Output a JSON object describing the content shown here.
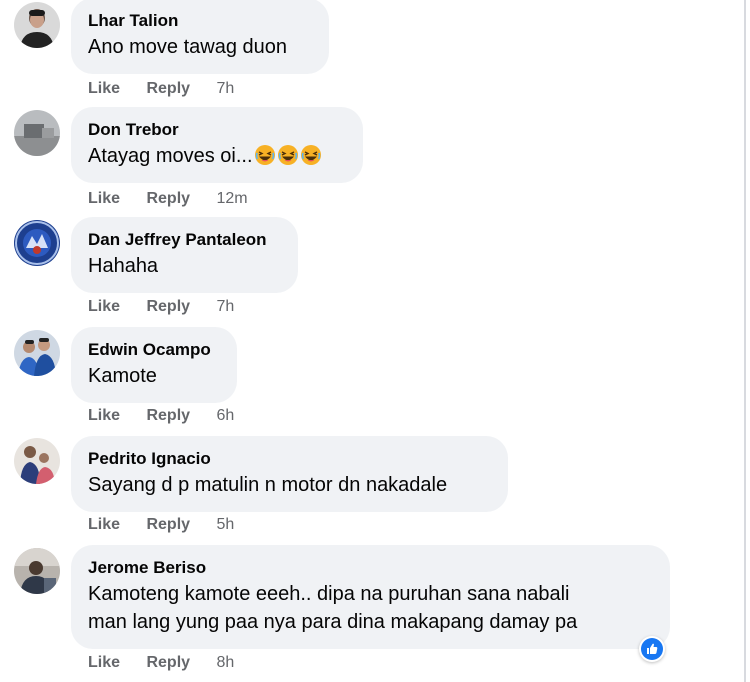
{
  "comments": [
    {
      "author": "Lhar Talion",
      "text": "Ano move tawag duon",
      "like": "Like",
      "reply": "Reply",
      "time": "7h"
    },
    {
      "author": "Don Trebor",
      "text": "Atayag moves oi...",
      "like": "Like",
      "reply": "Reply",
      "time": "12m"
    },
    {
      "author": "Dan Jeffrey Pantaleon",
      "text": "Hahaha",
      "like": "Like",
      "reply": "Reply",
      "time": "7h"
    },
    {
      "author": "Edwin Ocampo",
      "text": "Kamote",
      "like": "Like",
      "reply": "Reply",
      "time": "6h"
    },
    {
      "author": "Pedrito Ignacio",
      "text": "Sayang d p matulin n motor dn nakadale",
      "like": "Like",
      "reply": "Reply",
      "time": "5h"
    },
    {
      "author": "Jerome Beriso",
      "text_line1": "Kamoteng kamote eeeh.. dipa na puruhan sana nabali",
      "text_line2": "man lang yung paa nya para dina makapang damay pa",
      "like": "Like",
      "reply": "Reply",
      "time": "8h"
    }
  ],
  "icons": {
    "laughing_emoji": "laughing-emoji-icon",
    "like_reaction": "like-reaction-icon"
  },
  "colors": {
    "bubble": "#f0f2f5",
    "meta_text": "#65676b",
    "like_blue": "#1877f2",
    "emoji_yellow": "#f7b125"
  }
}
